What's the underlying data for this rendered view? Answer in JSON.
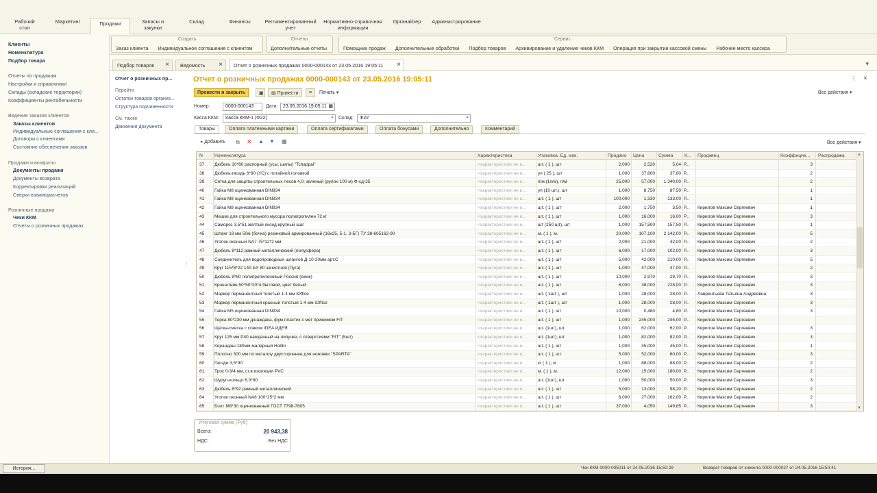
{
  "nav": [
    "Рабочий стол",
    "Маркетинг",
    "Продажи",
    "Запасы и закупки",
    "Склад",
    "Финансы",
    "Регламентированный учет",
    "Нормативно-справочная информация",
    "Органайзер",
    "Администрирование"
  ],
  "cmd": {
    "create": {
      "title": "Создать",
      "items": [
        "Заказ клиента",
        "Индивидуальное соглашение с клиентом"
      ]
    },
    "reports": {
      "title": "Отчеты",
      "items": [
        "Дополнительные отчеты"
      ]
    },
    "service": {
      "title": "Сервис",
      "items": [
        "Помощник продаж",
        "Дополнительные обработки",
        "Подбор товаров",
        "Архивирование и удаление чеков ККМ",
        "Операция при закрытии кассовой смены",
        "Рабочее место кассира"
      ]
    }
  },
  "sidebar": {
    "top": [
      "Клиенты",
      "Номенклатура",
      "Подбор товара"
    ],
    "links": [
      "Отчеты по продажам",
      "Настройки и справочники",
      "Склады (складские территории)",
      "Коэффициенты рентабельности"
    ],
    "sec1": "Ведение заказов клиентов",
    "sec1_items": [
      "Заказы клиентов",
      "Индивидуальные соглашения с кли...",
      "Договоры с клиентами",
      "Состояние обеспечения заказов"
    ],
    "sec2": "Продажи и возвраты",
    "sec2_items": [
      "Документы продажи",
      "Документы возврата",
      "Корректировки реализаций",
      "Сверки взаиморасчетов"
    ],
    "sec3": "Розничные продажи",
    "sec3_items": [
      "Чеки ККМ",
      "Отчеты о розничных продажах"
    ]
  },
  "tabs": [
    "Подбор товаров",
    "Ведомость",
    "Отчет о розничных продажах 0000-000143 от 23.05.2016 19:05:11"
  ],
  "left_panel": {
    "current": "Отчет о розничных пр...",
    "goto": "Перейти",
    "goto_items": [
      "Остатки товаров организ...",
      "Структура подчиненности"
    ],
    "see": "См. также",
    "see_items": [
      "Движения документа"
    ]
  },
  "doc": {
    "title": "Отчет о розничных продажах 0000-000143 от 23.05.2016 19:05:11",
    "post_close": "Провести и закрыть",
    "post": "Провести",
    "print": "Печать ▾",
    "all_actions": "Все действия ▾",
    "number_label": "Номер:",
    "number": "0000-000143",
    "date_label": "Дата:",
    "date": "23.05.2016 19:05:11",
    "kkm_label": "Касса ККМ:",
    "kkm": "Касса ККМ-1 (Ф22)",
    "warehouse_label": "Склад:",
    "warehouse": "Ф22"
  },
  "form_tabs": [
    "Товары",
    "Оплата платежными картами",
    "Оплата сертификатами",
    "Оплата бонусами",
    "Дополнительно",
    "Комментарий"
  ],
  "grid_toolbar": {
    "add": "Добавить",
    "all_actions": "Все действия ▾"
  },
  "columns": [
    "N",
    "Номенклатура",
    "Характеристика",
    "Упаковка, Ед. изм.",
    "Продано",
    "Цена",
    "Сумма",
    "К...",
    "Продавец",
    "Коэффицие...",
    "Распродажа"
  ],
  "rows": [
    [
      "37",
      "Дюбель 10*60 распорный (усы, шипы) \"Tchappai\"",
      "<характеристики не и...",
      "шт. ( 1 ), шт",
      "2,000",
      "2,520",
      "5,04",
      "Р...",
      "",
      "3",
      ""
    ],
    [
      "38",
      "Дюбель-гвоздь 6*60 (УС) с потайной головкой",
      "<характеристики не и...",
      "уп ( 25 ), шт",
      "1,000",
      "37,800",
      "37,80",
      "Р...",
      "",
      "2",
      ""
    ],
    [
      "39",
      "Сетка для защиты строительных лесов 4,0; зеленый (рулон 100 м) Ф-сд-35",
      "<характеристики не и...",
      "п/м (1п/м), п/м",
      "25,000",
      "57,000",
      "1 340,00",
      "Р...",
      "",
      "2",
      ""
    ],
    [
      "40",
      "Гайка М8 оцинкованная DIN934",
      "<характеристики не и...",
      "уп (10 шт.), шт",
      "1,000",
      "8,750",
      "87,50",
      "Р...",
      "",
      "1",
      ""
    ],
    [
      "41",
      "Гайка М8 оцинкованная DIN934",
      "<характеристики не и...",
      "шт. ( 1 ), шт",
      "100,000",
      "1,330",
      "133,00",
      "Р...",
      "",
      "1",
      ""
    ],
    [
      "42",
      "Гайка М8 оцинкованная DIN934",
      "<характеристики не и...",
      "шт. ( 1 ), шт",
      "2,000",
      "1,750",
      "3,50",
      "Р...",
      "Кирилов Максим Сергеевич",
      "1",
      ""
    ],
    [
      "43",
      "Мешки для строительного мусора полипропилен 72 кг",
      "<характеристики не и...",
      "шт. ( 1 ), шт",
      "1,000",
      "16,000",
      "16,00",
      "Р...",
      "Кирилов Максим Сергеевич",
      "3",
      ""
    ],
    [
      "44",
      "Саморез 3,5*51 желтый оксид крупный шаг",
      "<характеристики не и...",
      "шт (250 шт), шт",
      "1,000",
      "157,500",
      "157,50",
      "Р...",
      "Кирилов Максим Сергеевич",
      "1",
      ""
    ],
    [
      "45",
      "Шланг 18 мм 50м (бочка) резиновый армированный (16x25, 5-1. 3-БГ) ТУ 38-605162-90",
      "<характеристики не и...",
      "м. ( 1 ), м.",
      "20,000",
      "107,100",
      "2 142,00",
      "Р...",
      "Кирилов Максим Сергеевич",
      "5",
      ""
    ],
    [
      "46",
      "Уголок оконный NA7 75*12*2 мм",
      "<характеристики не и...",
      "шт. ( 1 ), шт",
      "2,000",
      "21,000",
      "42,00",
      "Р...",
      "Кирилов Максим Сергеевич",
      "2",
      ""
    ],
    [
      "47",
      "Дюбель 8*112 рамный металлический (полусфера)",
      "<характеристики не и...",
      "шт. ( 1 ), шт",
      "6,000",
      "17,000",
      "102,00",
      "Р...",
      "Кирилов Максим Сергеевич",
      "3",
      ""
    ],
    [
      "48",
      "Соединитель для водопроводных шлангов Д-10-20мм арт.С",
      "<характеристики не и...",
      "шт. ( 1 ), шт",
      "5,000",
      "42,000",
      "210,00",
      "Р...",
      "Кирилов Максим Сергеевич",
      "5",
      ""
    ],
    [
      "49",
      "Круг 115*6*22 14А БУ 80 зачистной (Луга)",
      "<характеристики не и...",
      "шт. ( 1 ), шт",
      "1,000",
      "47,000",
      "47,00",
      "Р...",
      "",
      "2",
      ""
    ],
    [
      "50",
      "Дюбель 8*80 полипропиленовый Россия (ежик)",
      "<характеристики не и...",
      "шт. ( 1 ), шт",
      "10,000",
      "2,970",
      "29,70",
      "Р...",
      "Кирилов Максим Сергеевич",
      "3",
      ""
    ],
    [
      "51",
      "Кронштейн 50*50*20*4 бытовой, цвет белый",
      "<характеристики не и...",
      "шт. ( 1 ), шт",
      "6,000",
      "38,000",
      "228,00",
      "Р...",
      "Кирилов Максим Сергеевич",
      "3",
      ""
    ],
    [
      "52",
      "Маркер перманентный толстый 1-4 мм iOffice",
      "<характеристики не и...",
      "шт. ( 1шт ), шт",
      "1,000",
      "28,000",
      "28,00",
      "Р...",
      "Лаврентьева Татьяна Андреевна",
      "3",
      ""
    ],
    [
      "53",
      "Маркер перманентный красный толстый 1-4 мм iOffice",
      "<характеристики не и...",
      "шт. ( 1шт ), шт",
      "1,000",
      "28,000",
      "28,00",
      "Р...",
      "Кирилов Максим Сергеевич",
      "3",
      ""
    ],
    [
      "54",
      "Гайка М5 оцинкованная DIN934",
      "<характеристики не и...",
      "шт. ( 1 ), шт",
      "10,000",
      "0,480",
      "4,80",
      "Р...",
      "Кирилов Максим Сергеевич",
      "3",
      ""
    ],
    [
      "55",
      "Терка 80*230 мм д/наждака, фум.пластик с мет прижимом FIT",
      "<характеристики не и...",
      "шт. ( 1 ), шт",
      "1,000",
      "245,000",
      "245,00",
      "Р...",
      "Кирилов Максим Сергеевич",
      "",
      ""
    ],
    [
      "56",
      "Щетка-сметка с совком IDEA ИДЕЯ",
      "<характеристики не и...",
      "шт. (1шт), шт",
      "1,000",
      "62,000",
      "62,00",
      "Р...",
      "Кирилов Максим Сергеевич",
      "3",
      ""
    ],
    [
      "57",
      "Круг 125 мм Р40 наждачный на липучке, с отверстиями \"FIT\" (5шт)",
      "<характеристики не и...",
      "шт. (1шт), шт",
      "1,000",
      "82,000",
      "82,00",
      "Р...",
      "Кирилов Максим Сергеевич",
      "3",
      ""
    ],
    [
      "58",
      "Керандаш 180мм малярный Hobbi",
      "<характеристики не и...",
      "шт. ( 1 ), шт",
      "1,000",
      "45,000",
      "45,00",
      "Р...",
      "Кирилов Максим Сергеевич",
      "1",
      ""
    ],
    [
      "59",
      "Полотно 300 мм по металлу двустороннее для ножовки \"SPARTA\"",
      "<характеристики не и...",
      "шт. ( 1 ), шт",
      "5,000",
      "52,000",
      "60,00",
      "Р...",
      "Кирилов Максим Сергеевич",
      "3",
      ""
    ],
    [
      "60",
      "Гвозди 3,5*90",
      "<характеристики не и...",
      "кг ( 1 ), кг",
      "1,000",
      "88,000",
      "88,00",
      "Р...",
      "Кирилов Максим Сергеевич",
      "2",
      ""
    ],
    [
      "61",
      "Трос 0-3/4 мм, ст.в изоляции PVC",
      "<характеристики не и...",
      "м. ( 1 ), м.",
      "12,000",
      "15,000",
      "180,00",
      "Р...",
      "Кирилов Максим Сергеевич",
      "2",
      ""
    ],
    [
      "62",
      "Шуруп-кольцо 6,0*80",
      "<характеристики не и...",
      "шт. (1шт), шт",
      "1,000",
      "50,000",
      "50,00",
      "Р...",
      "Кирилов Максим Сергеевич",
      "3",
      ""
    ],
    [
      "63",
      "Дюбель 8*92 рамный металлический",
      "<характеристики не и...",
      "шт. ( 1 ), шт",
      "5,000",
      "13,000",
      "98,20",
      "Р...",
      "Кирилов Максим Сергеевич",
      "2",
      ""
    ],
    [
      "64",
      "Уголок оконный NA8 100*15*2 мм",
      "<характеристики не и...",
      "шт. ( 1 ), шт",
      "6,000",
      "27,000",
      "162,00",
      "Р...",
      "Кирилов Максим Сергеевич",
      "2",
      ""
    ],
    [
      "65",
      "Болт М8*30 оцинкованный ГОСТ 7798-7805",
      "<характеристики не и...",
      "шт. ( 1 ), шт",
      "37,000",
      "4,050",
      "149,85",
      "Р...",
      "Кирилов Максим Сергеевич",
      "3",
      ""
    ]
  ],
  "totals": {
    "title": "Итоговая сумма (Руб)",
    "total_label": "Всего:",
    "total": "20 943,38",
    "vat_label": "НДС:",
    "vat": "Без НДС"
  },
  "status": {
    "history": "История...",
    "msg1": "Чек ККМ 0000-005011 от 24.05.2016 15:50:29",
    "msg2": "Возврат товаров от клиента 0000-000027 от 24.05.2016 15:50:41"
  }
}
